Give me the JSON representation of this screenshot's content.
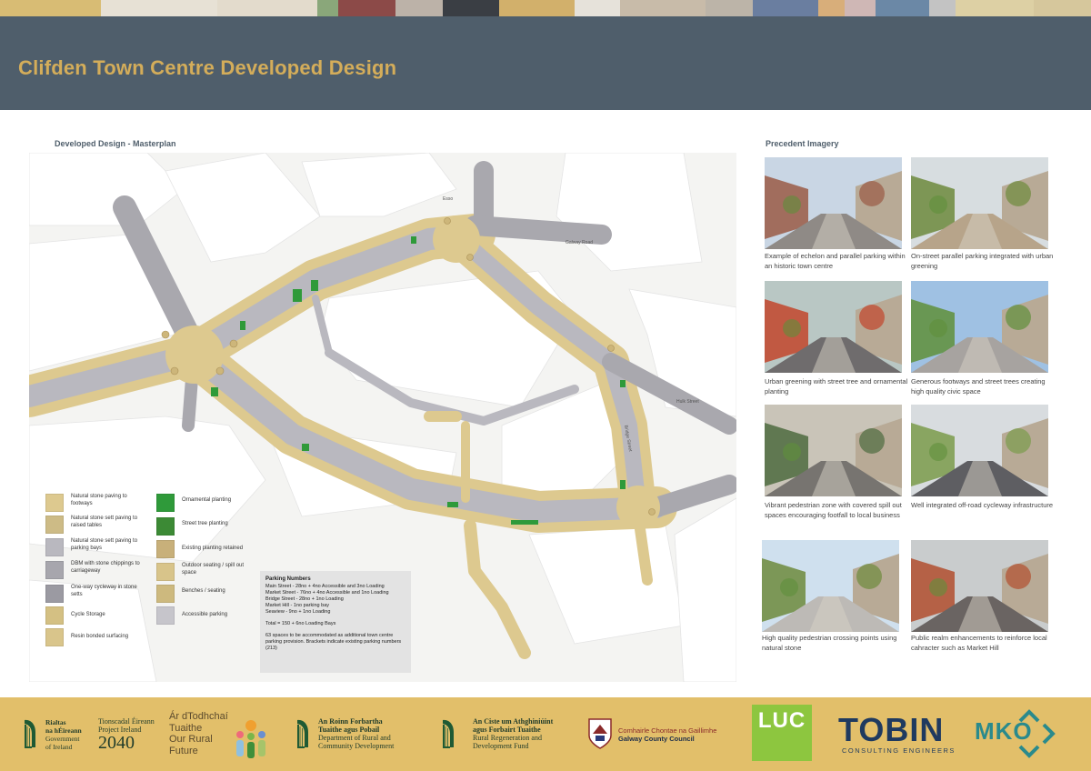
{
  "palette_strip": [
    "#d8bc74",
    "#e7e1d5",
    "#e3dbcc",
    "#8aa77a",
    "#8c4a48",
    "#bcb2a8",
    "#3a3e44",
    "#d2b06b",
    "#e6e2da",
    "#c8bba9",
    "#bcb4a8",
    "#6a7ea0",
    "#d8ae7a",
    "#cfb7b5",
    "#6b88a6",
    "#c3c3c3",
    "#ddd0a4",
    "#d6c79c",
    "#e7e1d3"
  ],
  "colors": {
    "header_bg": "#4f5e6b",
    "title": "#d4ad5a",
    "footer_bg": "#e2bf6a",
    "paving": "#ddc98f",
    "road": "#a9a8ae",
    "planting": "#2f9a3a"
  },
  "header": {
    "title": "Clifden Town Centre Developed Design"
  },
  "masterplan": {
    "title": "Developed Design - Masterplan",
    "street_labels": [
      "Galway Road",
      "Esso",
      "Hulk Street",
      "Bridge Street"
    ],
    "legend": [
      {
        "label": "Natural stone paving to footways",
        "swatch": "#ddc98f",
        "icon": "paving-swatch"
      },
      {
        "label": "Natural stone sett paving to raised tables",
        "swatch": "#cdbb86",
        "icon": "sett-swatch"
      },
      {
        "label": "Natural stone sett paving to parking bays",
        "swatch": "#b9b8bf",
        "icon": "parking-swatch"
      },
      {
        "label": "DBM with stone chippings to carriageway",
        "swatch": "#a7a6ad",
        "icon": "carriageway-swatch"
      },
      {
        "label": "One-way cycleway in stone setts",
        "swatch": "#9b9aa2",
        "icon": "cycleway-swatch"
      },
      {
        "label": "Cycle Storage",
        "swatch": "#d4c083",
        "icon": "cycle-storage-swatch"
      },
      {
        "label": "Resin bonded surfacing",
        "swatch": "#d9c58b",
        "icon": "resin-swatch"
      },
      {
        "label": "Ornamental planting",
        "swatch": "#2f9a3a",
        "icon": "ornamental-planting-swatch"
      },
      {
        "label": "Street tree planting",
        "swatch": "#3c8a35",
        "icon": "street-tree-swatch"
      },
      {
        "label": "Existing planting retained",
        "swatch": "#c8b07a",
        "icon": "existing-planting-swatch"
      },
      {
        "label": "Outdoor seating / spill out space",
        "swatch": "#d8c48a",
        "icon": "seating-swatch"
      },
      {
        "label": "Benches / seating",
        "swatch": "#cdb97e",
        "icon": "benches-swatch"
      },
      {
        "label": "Accessible parking",
        "swatch": "#c6c5cb",
        "icon": "accessible-parking-swatch"
      }
    ],
    "parking": {
      "title": "Parking Numbers",
      "lines": [
        "Main Street - 28no + 4no Accessible and 3no Loading",
        "Market Street - 76no + 4no Accessible and 1no Loading",
        "Bridge Street - 28no + 1no Loading",
        "Market Hill - 1no parking bay",
        "Seaview - 9no + 1no Loading"
      ],
      "total": "Total = 150 + 6no Loading Bays",
      "note": "63 spaces to be accommodated as additional town centre parking provision. Brackets indicate existing parking numbers (213)"
    }
  },
  "precedent": {
    "title": "Precedent Imagery",
    "items": [
      {
        "caption": "Example of echelon and parallel parking within an historic town centre",
        "sky": "#c9d6e4",
        "ground": "#8f8a86",
        "accent": "#9a5a45"
      },
      {
        "caption": "On-street parallel parking integrated with urban greening",
        "sky": "#d7dde0",
        "ground": "#b7a48a",
        "accent": "#6d8a3c"
      },
      {
        "caption": "Urban greening with street tree and ornamental planting",
        "sky": "#b9c7c4",
        "ground": "#6f6c6d",
        "accent": "#c2452b"
      },
      {
        "caption": "Generous footways and street trees creating high quality civic space",
        "sky": "#9fc1e3",
        "ground": "#a7a3a0",
        "accent": "#5f8f3a"
      },
      {
        "caption": "Vibrant pedestrian zone with covered spill out spaces encouraging footfall to local business",
        "sky": "#c9c4b8",
        "ground": "#777470",
        "accent": "#4d6b3e"
      },
      {
        "caption": "Well integrated off-road cycleway infrastructure",
        "sky": "#d8dcdf",
        "ground": "#5e5e62",
        "accent": "#7b9b4b"
      },
      {
        "caption": "High quality pedestrian crossing points using natural stone",
        "sky": "#cfe0ee",
        "ground": "#bdbab6",
        "accent": "#6d8a3c"
      },
      {
        "caption": "Public realm enhancements to reinforce local cahracter such as Market Hill",
        "sky": "#c9cccd",
        "ground": "#6a6462",
        "accent": "#b24e2e"
      }
    ]
  },
  "footer": {
    "gov": [
      "Rialtas",
      "na hÉireann",
      "Government",
      "of Ireland"
    ],
    "pi": [
      "Tionscadal Éireann",
      "Project Ireland",
      "2040"
    ],
    "rural": [
      "Ár dTodhchaí",
      "Tuaithe",
      "Our Rural",
      "Future"
    ],
    "drcd": [
      "An Roinn Forbartha",
      "Tuaithe agus Pobail",
      "Department of Rural and",
      "Community Development"
    ],
    "rrdf": [
      "An Ciste um Athghiniúint",
      "agus Forbairt Tuaithe",
      "Rural Regeneration and",
      "Development Fund"
    ],
    "gcc": [
      "Comhairle Chontae na Gaillimhe",
      "Galway County Council"
    ],
    "luc": "LUC",
    "tobin": "TOBIN",
    "tobin_sub": "CONSULTING ENGINEERS",
    "mko": "MKO"
  }
}
